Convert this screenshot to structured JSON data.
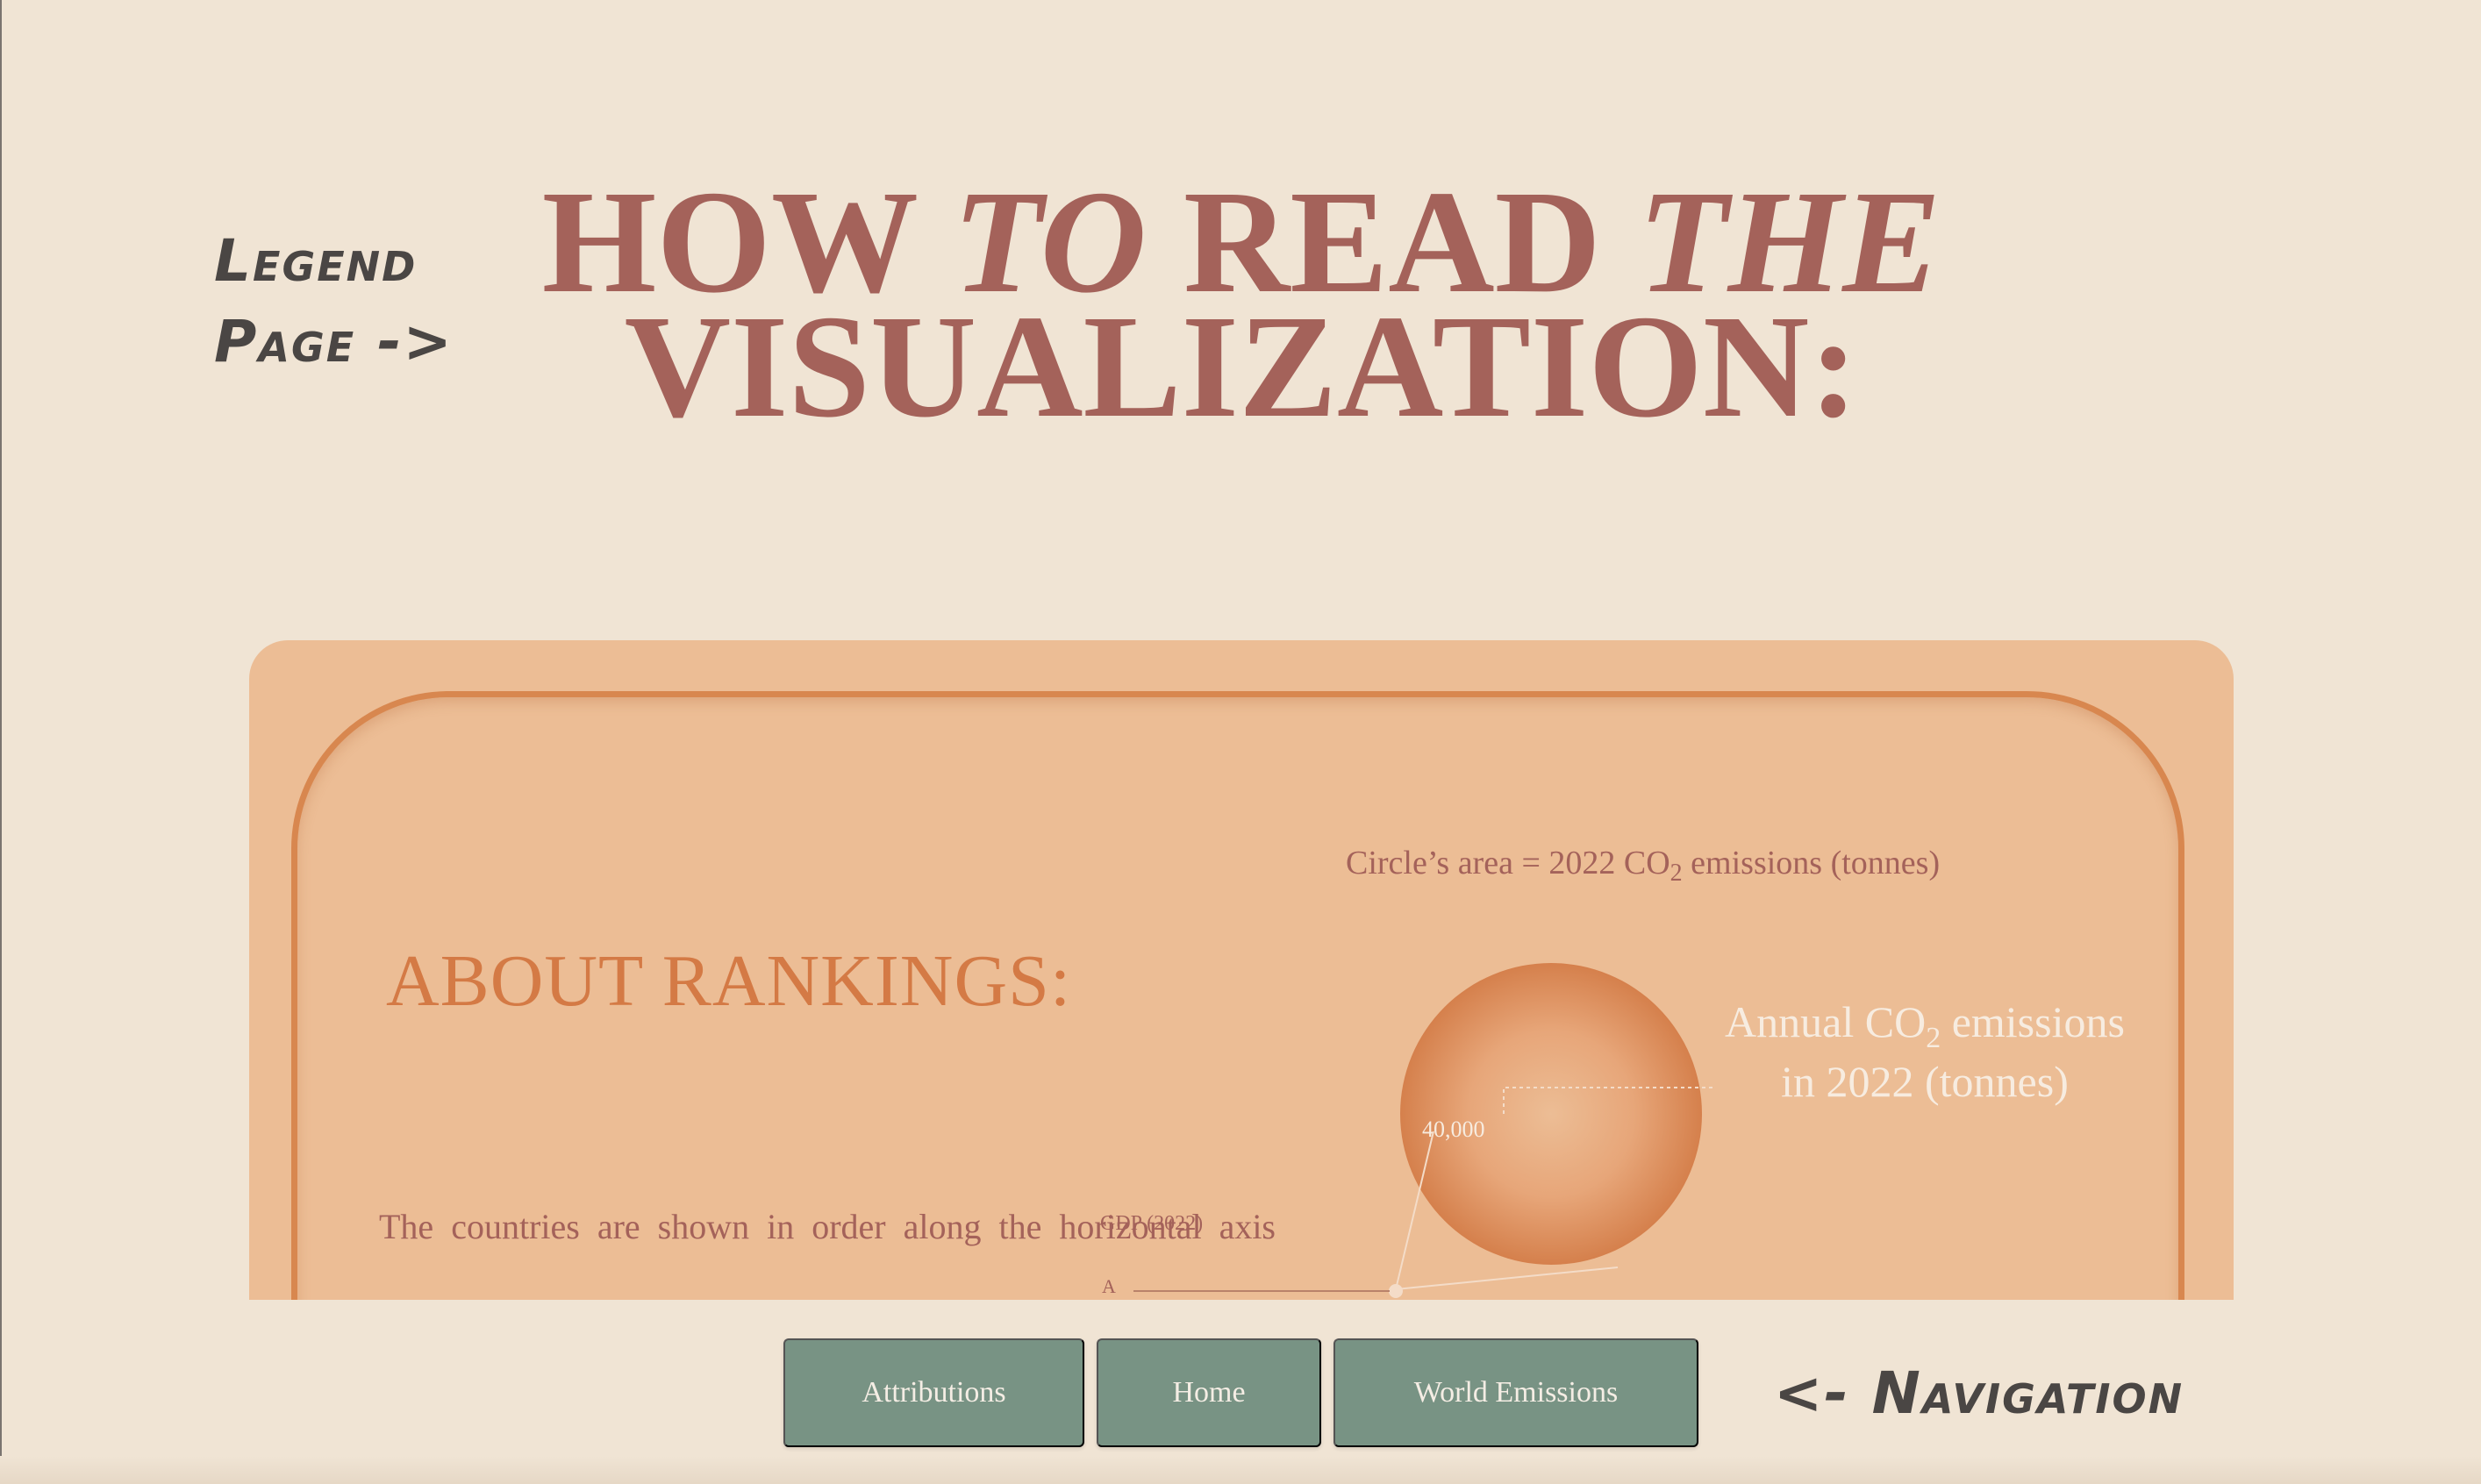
{
  "notes": {
    "legend_line1": "Legend",
    "legend_line2": "Page ->",
    "navigation": "<- Navigation"
  },
  "title": {
    "w1": "HOW",
    "w2": "TO",
    "w3": "READ",
    "w4": "THE",
    "w5": "VISUALIZATION:"
  },
  "card": {
    "section_title": "ABOUT RANKINGS:",
    "body_text": "The countries are shown in order along the horizontal axis",
    "legend": {
      "area_label_prefix": "Circle’s area = 2022 CO",
      "area_label_sub": "2",
      "area_label_suffix": " emissions (tonnes)",
      "circle_value": "40,000",
      "annual_line1_prefix": "Annual CO",
      "annual_line1_sub": "2",
      "annual_line1_suffix": " emissions",
      "annual_line2": "in 2022 (tonnes)",
      "gdp_label": "GDP (2022)",
      "axis_marker": "A"
    }
  },
  "nav": {
    "attributions": "Attributions",
    "home": "Home",
    "world_emissions": "World Emissions"
  },
  "colors": {
    "background": "#f0e4d4",
    "title": "#a4625a",
    "card": "#ecbd95",
    "card_frame": "#d8874f",
    "section_title": "#d47a45",
    "nav_button": "#789384"
  }
}
